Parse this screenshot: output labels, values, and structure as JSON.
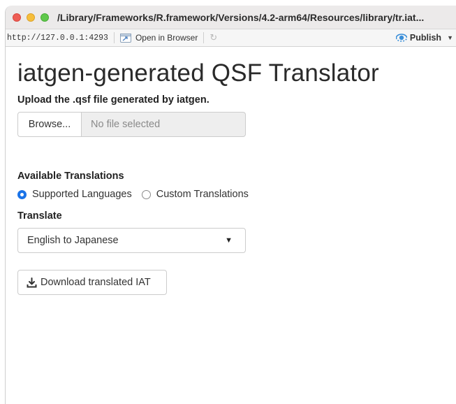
{
  "window": {
    "title": "/Library/Frameworks/R.framework/Versions/4.2-arm64/Resources/library/tr.iat..."
  },
  "toolbar": {
    "url": "http://127.0.0.1:4293",
    "open_in_browser": "Open in Browser",
    "publish": "Publish"
  },
  "page": {
    "title": "iatgen-generated QSF Translator",
    "upload": {
      "label": "Upload the .qsf file generated by iatgen.",
      "browse_label": "Browse...",
      "file_placeholder": "No file selected"
    },
    "translations": {
      "label": "Available Translations",
      "options": [
        {
          "label": "Supported Languages",
          "checked": true
        },
        {
          "label": "Custom Translations",
          "checked": false
        }
      ]
    },
    "translate": {
      "label": "Translate",
      "selected": "English to Japanese"
    },
    "download_label": "Download translated IAT"
  },
  "colors": {
    "accent": "#1a73e8",
    "close": "#ee5d55",
    "minimize": "#f6be3b",
    "zoom": "#5fc84b"
  }
}
